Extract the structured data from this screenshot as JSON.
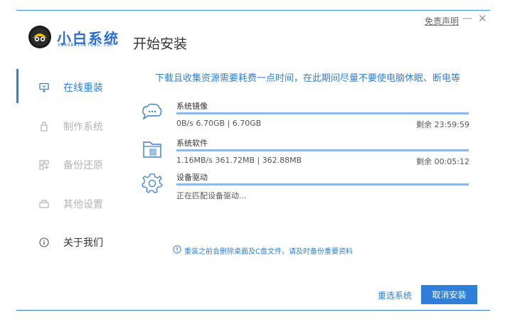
{
  "header": {
    "logo_name": "小白系统",
    "logo_sub": "XIAOBAIXITONG.COM",
    "page_title": "开始安装",
    "disclaimer": "免责声明",
    "minimize": "—",
    "close": "✕"
  },
  "sidebar": {
    "items": [
      {
        "label": "在线重装",
        "icon": "monitor-icon",
        "state": "active"
      },
      {
        "label": "制作系统",
        "icon": "usb-icon",
        "state": "disabled"
      },
      {
        "label": "备份还原",
        "icon": "backup-icon",
        "state": "disabled"
      },
      {
        "label": "其他设置",
        "icon": "settings-box-icon",
        "state": "disabled"
      },
      {
        "label": "关于我们",
        "icon": "info-icon",
        "state": "normal"
      }
    ]
  },
  "main": {
    "notice": "下载且收集资源需要耗费一点时间，在此期间尽量不要使电脑休眠、断电等",
    "tasks": [
      {
        "name": "系统镜像",
        "stats": "0B/s 6.70GB | 6.70GB",
        "remaining": "剩余 23:59:59",
        "progress": 1.0,
        "icon": "image-icon"
      },
      {
        "name": "系统软件",
        "stats": "1.16MB/s 361.72MB | 362.88MB",
        "remaining": "剩余 00:05:12",
        "progress": 1.0,
        "icon": "software-icon"
      },
      {
        "name": "设备驱动",
        "stats": "正在匹配设备驱动...",
        "remaining": "",
        "progress": 1.0,
        "icon": "gear-icon"
      }
    ],
    "warning": "重装之前会删除桌面及C盘文件，请及时备份重要资料"
  },
  "footer": {
    "reselect_label": "重选系统",
    "cancel_label": "取消安装"
  },
  "colors": {
    "accent": "#2f7fd8",
    "progress_fill": "#8cb8ea",
    "progress_track": "#dfe9f5"
  }
}
